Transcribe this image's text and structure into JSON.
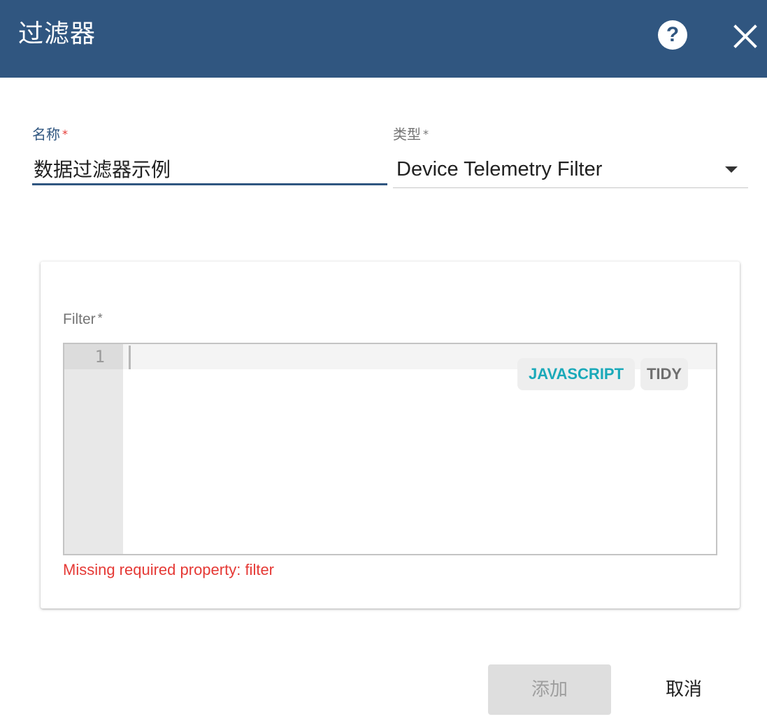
{
  "dialog": {
    "title": "过滤器",
    "help_icon": "question-circle-icon",
    "help_glyph": "?",
    "close_icon": "close-icon",
    "header_color": "#305680"
  },
  "form": {
    "name": {
      "label": "名称",
      "required_mark": "*",
      "value": "数据过滤器示例"
    },
    "type": {
      "label": "类型",
      "required_mark": "*",
      "selected": "Device Telemetry Filter",
      "icon": "dropdown-arrow-icon"
    }
  },
  "filter_editor": {
    "label": "Filter",
    "required_mark": "*",
    "line_numbers": [
      "1"
    ],
    "language_button": "JAVASCRIPT",
    "tidy_button": "TIDY",
    "error_message": "Missing required property: filter",
    "error_color": "#e53935",
    "language_color": "#1aa9b9"
  },
  "actions": {
    "add_label": "添加",
    "add_disabled": true,
    "cancel_label": "取消"
  }
}
